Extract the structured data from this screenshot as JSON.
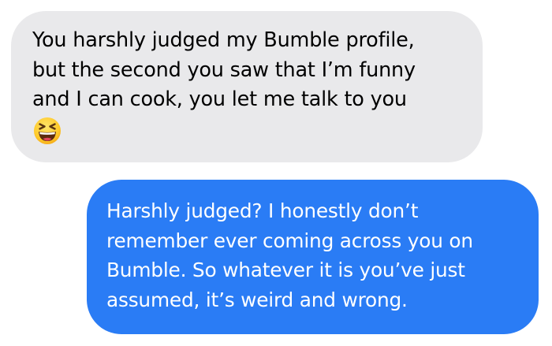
{
  "conversation": {
    "incoming_message": {
      "lines": [
        "You harshly judged my Bumble profile,",
        "but the second you saw that I’m funny",
        "and I can cook, you let me talk to you"
      ],
      "emoji_icon": "laughing-squinting-face-icon"
    },
    "outgoing_message": {
      "lines": [
        "Harshly judged? I honestly don’t",
        "remember ever coming across you on",
        "Bumble. So whatever it is you’ve just",
        "assumed, it’s weird and wrong."
      ]
    }
  },
  "colors": {
    "incoming_bubble": "#e9e9eb",
    "outgoing_bubble": "#2a7cf5",
    "background": "#ffffff"
  }
}
